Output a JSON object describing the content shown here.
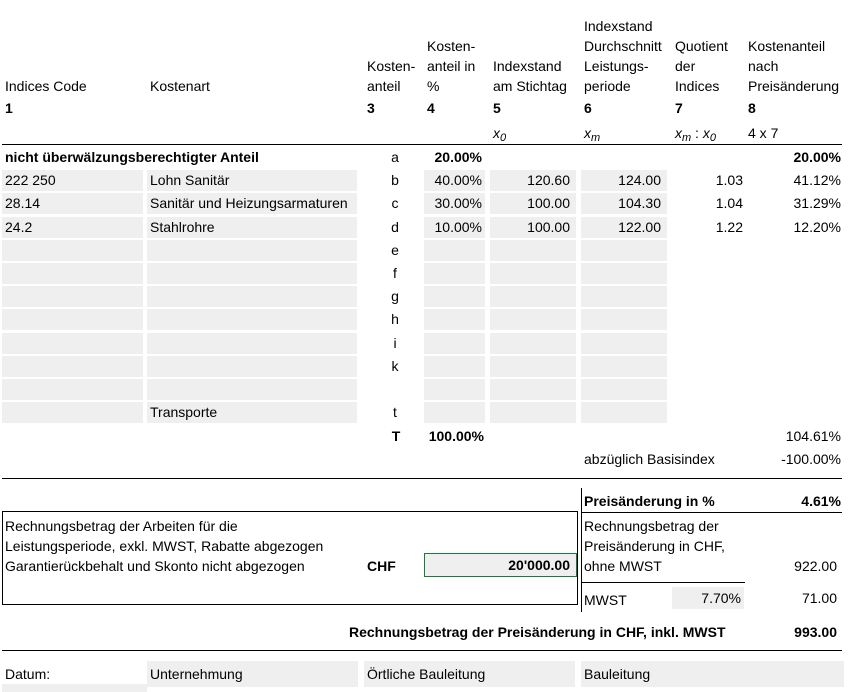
{
  "headers": {
    "c1": "Indices Code",
    "c2": "Kostenart",
    "c3": [
      "Kosten-",
      "anteil"
    ],
    "c4": [
      "Kosten-",
      "anteil in",
      "%"
    ],
    "c5": [
      "Indexstand",
      "am Stichtag"
    ],
    "c6": [
      "Indexstand",
      "Durchschnitt",
      "Leistungs-",
      "periode"
    ],
    "c7": [
      "Quotient",
      "der",
      "Indices"
    ],
    "c8": [
      "Kostenanteil",
      "nach",
      "Preisänderung"
    ],
    "nums": [
      "1",
      "3",
      "4",
      "5",
      "6",
      "7",
      "8"
    ],
    "symbols": {
      "s5": "x",
      "s5sub": "0",
      "s6": "x",
      "s6sub": "m",
      "s7a": "x",
      "s7asub": "m",
      "s7sep": " : ",
      "s7b": "x",
      "s7bsub": "0",
      "s8": "4 x 7"
    }
  },
  "rows": [
    {
      "code": "nicht überwälzungsberechtigter Anteil",
      "art": "",
      "letter": "a",
      "pct": "20.00%",
      "x0": "",
      "xm": "",
      "q": "",
      "k": "20.00%"
    },
    {
      "code": "222 250",
      "art": "Lohn Sanitär",
      "letter": "b",
      "pct": "40.00%",
      "x0": "120.60",
      "xm": "124.00",
      "q": "1.03",
      "k": "41.12%"
    },
    {
      "code": "28.14",
      "art": "Sanitär und Heizungsarmaturen",
      "letter": "c",
      "pct": "30.00%",
      "x0": "100.00",
      "xm": "104.30",
      "q": "1.04",
      "k": "31.29%"
    },
    {
      "code": "24.2",
      "art": "Stahlrohre",
      "letter": "d",
      "pct": "10.00%",
      "x0": "100.00",
      "xm": "122.00",
      "q": "1.22",
      "k": "12.20%"
    },
    {
      "code": "",
      "art": "",
      "letter": "e",
      "pct": "",
      "x0": "",
      "xm": "",
      "q": "",
      "k": ""
    },
    {
      "code": "",
      "art": "",
      "letter": "f",
      "pct": "",
      "x0": "",
      "xm": "",
      "q": "",
      "k": ""
    },
    {
      "code": "",
      "art": "",
      "letter": "g",
      "pct": "",
      "x0": "",
      "xm": "",
      "q": "",
      "k": ""
    },
    {
      "code": "",
      "art": "",
      "letter": "h",
      "pct": "",
      "x0": "",
      "xm": "",
      "q": "",
      "k": ""
    },
    {
      "code": "",
      "art": "",
      "letter": "i",
      "pct": "",
      "x0": "",
      "xm": "",
      "q": "",
      "k": ""
    },
    {
      "code": "",
      "art": "",
      "letter": "k",
      "pct": "",
      "x0": "",
      "xm": "",
      "q": "",
      "k": ""
    },
    {
      "code": "",
      "art": "",
      "letter": "",
      "pct": "",
      "x0": "",
      "xm": "",
      "q": "",
      "k": ""
    },
    {
      "code": "",
      "art": "Transporte",
      "letter": "t",
      "pct": "",
      "x0": "",
      "xm": "",
      "q": "",
      "k": ""
    }
  ],
  "total": {
    "letter": "T",
    "pct": "100.00%",
    "k": "104.61%"
  },
  "basis": {
    "label": "abzüglich Basisindex",
    "value": "-100.00%"
  },
  "preis": {
    "label": "Preisänderung in %",
    "value": "4.61%"
  },
  "rechnung": {
    "lines": [
      "Rechnungsbetrag der Arbeiten für die",
      "Leistungsperiode, exkl. MWST, Rabatte abgezogen",
      "Garantierückbehalt und Skonto nicht abgezogen"
    ],
    "currency": "CHF",
    "amount": "20'000.00"
  },
  "preisChf": {
    "lines": [
      "Rechnungsbetrag der",
      "Preisänderung in CHF,",
      "ohne MWST"
    ],
    "value": "922.00"
  },
  "mwst": {
    "label": "MWST",
    "rate": "7.70%",
    "value": "71.00"
  },
  "inkl": {
    "label": "Rechnungsbetrag der Preisänderung in CHF, inkl. MWST",
    "value": "993.00"
  },
  "footer": {
    "datum": "Datum:",
    "unternehmung": "Unternehmung",
    "oertlich": "Örtliche Bauleitung",
    "bauleitung": "Bauleitung"
  }
}
